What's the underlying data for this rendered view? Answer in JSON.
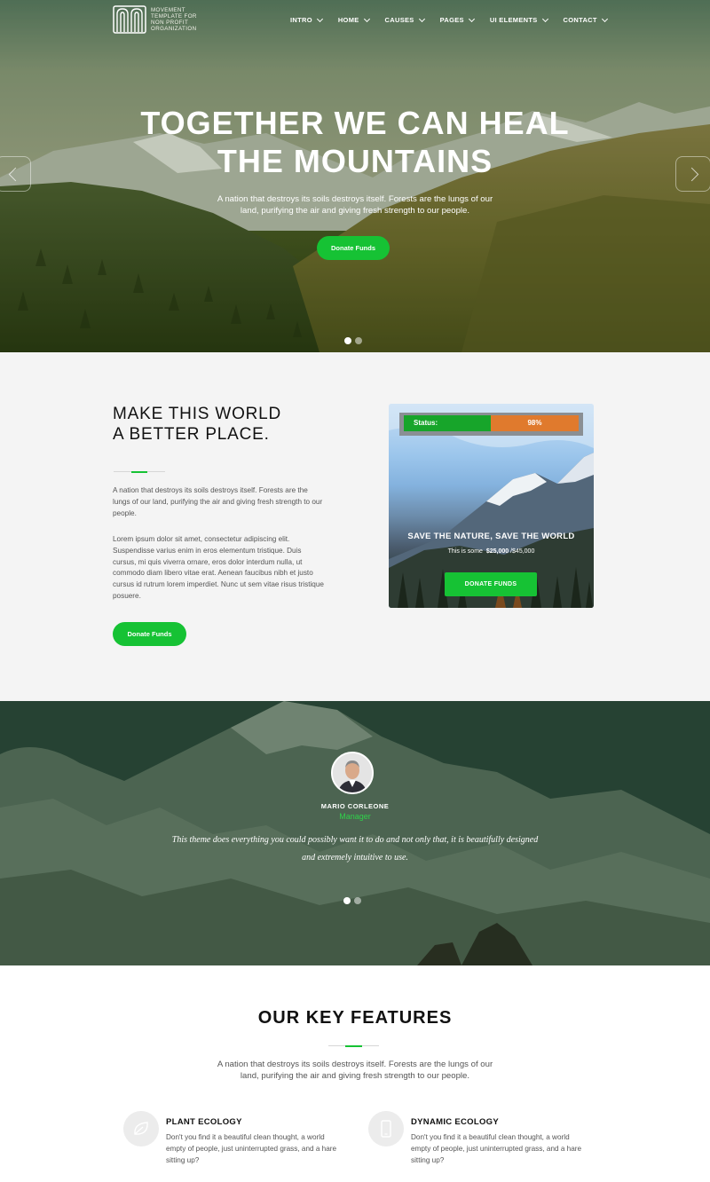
{
  "brand": {
    "logo_text": "MOVEMENT TEMPLATE FOR NON PROFIT ORGANIZATION"
  },
  "nav": {
    "items": [
      {
        "label": "INTRO"
      },
      {
        "label": "HOME"
      },
      {
        "label": "CAUSES"
      },
      {
        "label": "PAGES"
      },
      {
        "label": "UI ELEMENTS"
      },
      {
        "label": "CONTACT"
      }
    ]
  },
  "hero": {
    "title_line1": "TOGETHER WE CAN HEAL",
    "title_line2": "THE MOUNTAINS",
    "subtitle": "A nation that destroys its soils destroys itself. Forests are the lungs of our land, purifying the air and giving fresh strength to our people.",
    "button_label": "Donate Funds"
  },
  "about": {
    "heading_line1": "MAKE THIS WORLD",
    "heading_line2": "A BETTER PLACE.",
    "paragraph1": "A nation that destroys its soils destroys itself. Forests are the lungs of our land, purifying the air and giving fresh strength to our people.",
    "paragraph2": "Lorem ipsum dolor sit amet, consectetur adipiscing elit. Suspendisse varius enim in eros elementum tristique. Duis cursus, mi quis viverra ornare, eros dolor interdum nulla, ut commodo diam libero vitae erat. Aenean faucibus nibh et justo cursus id rutrum lorem imperdiet. Nunc ut sem vitae risus tristique posuere.",
    "button_label": "Donate Funds"
  },
  "cause_card": {
    "status_label": "Status:",
    "status_value": "98%",
    "progress_fraction": 0.98,
    "title": "SAVE THE NATURE, SAVE THE WORLD",
    "meta_prefix": "This is some",
    "raised": "$25,000",
    "goal": "/$45,000",
    "button_label": "DONATE FUNDS"
  },
  "testimonial": {
    "name": "MARIO CORLEONE",
    "role": "Manager",
    "quote": "This theme does everything you could possibly want it to do and not only that, it is beautifully designed and extremely intuitive to use."
  },
  "features": {
    "heading": "OUR KEY FEATURES",
    "intro": "A nation that destroys its soils destroys itself. Forests are the lungs of our land, purifying the air and giving fresh strength to our people.",
    "items": [
      {
        "title": "PLANT ECOLOGY",
        "text": "Don't you find it a beautiful clean thought, a world empty of people, just uninterrupted grass, and a hare sitting up?",
        "icon": "leaf-icon"
      },
      {
        "title": "DYNAMIC ECOLOGY",
        "text": "Don't you find it a beautiful clean thought, a world empty of people, just uninterrupted grass, and a hare sitting up?",
        "icon": "mobile-icon"
      }
    ]
  },
  "colors": {
    "accent_green": "#16c234",
    "status_green": "#17a52a",
    "status_orange": "#e07a2d",
    "section_grey": "#f4f4f4"
  }
}
